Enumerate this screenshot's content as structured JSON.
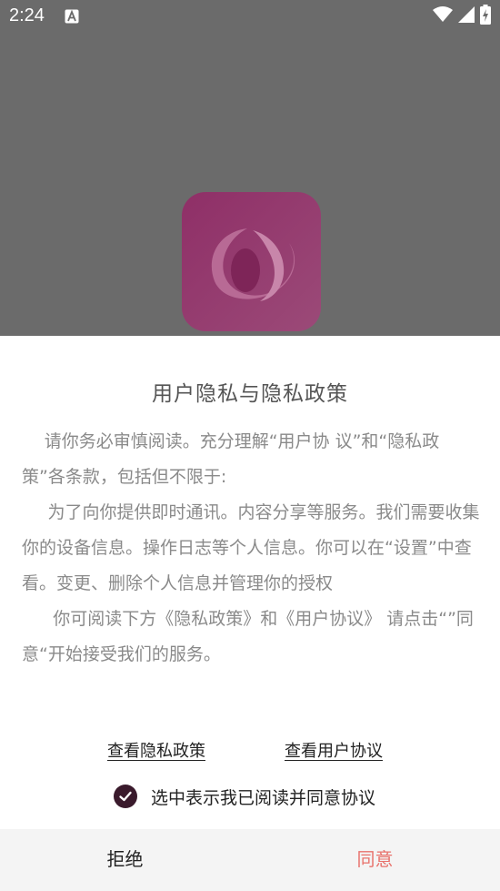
{
  "status_bar": {
    "time": "2:24",
    "notification_icon": "font-a-icon",
    "icons": [
      "wifi-icon",
      "signal-icon",
      "battery-charging-icon"
    ]
  },
  "splash": {
    "logo_icon": "brand-logo-icon",
    "overlay_color": "#6b6b6b"
  },
  "dialog": {
    "title": "用户隐私与隐私政策",
    "paragraphs": [
      "请你务必审慎阅读。充分理解“用户协 议”和“隐私政策”各条款，包括但不限于:",
      "为了向你提供即时通讯。内容分享等服务。我们需要收集你的设备信息。操作日志等个人信息。你可以在“设置”中查看。变更、删除个人信息并管理你的授权",
      "你可阅读下方《隐私政策》和《用户协议》 请点击“”同意“开始接受我们的服务。"
    ],
    "links": {
      "privacy": "查看隐私政策",
      "agreement": "查看用户协议"
    },
    "consent": {
      "label": "选中表示我已阅读并同意协议",
      "checked": true
    },
    "buttons": {
      "reject": "拒绝",
      "agree": "同意"
    },
    "colors": {
      "agree": "#e8726c",
      "checkbox": "#3a1a2c"
    }
  }
}
